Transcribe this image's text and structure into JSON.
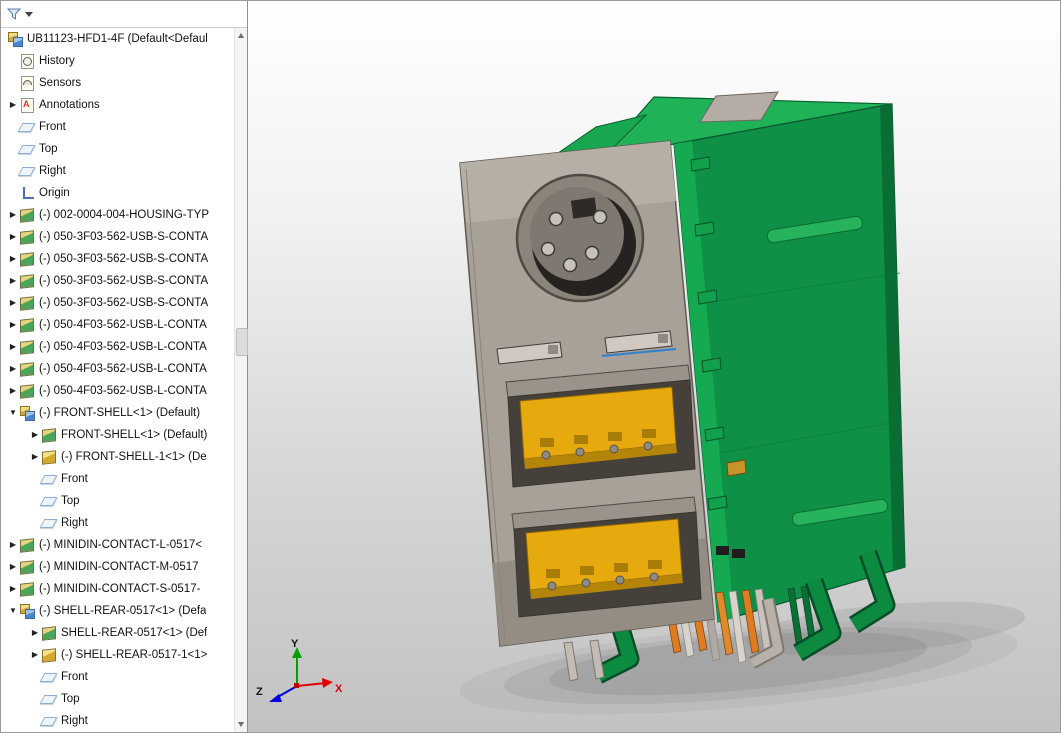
{
  "tree": {
    "root": {
      "label": "UB11123-HFD1-4F (Default<Defaul",
      "icon": "asm"
    },
    "items": [
      {
        "label": "History",
        "icon": "history",
        "arrow": "",
        "level": 1
      },
      {
        "label": "Sensors",
        "icon": "sensors",
        "arrow": "",
        "level": 1
      },
      {
        "label": "Annotations",
        "icon": "annotations",
        "arrow": "collapsed",
        "level": 1
      },
      {
        "label": "Front",
        "icon": "plane",
        "arrow": "",
        "level": 1
      },
      {
        "label": "Top",
        "icon": "plane",
        "arrow": "",
        "level": 1
      },
      {
        "label": "Right",
        "icon": "plane",
        "arrow": "",
        "level": 1
      },
      {
        "label": "Origin",
        "icon": "origin",
        "arrow": "",
        "level": 1
      },
      {
        "label": "(-) 002-0004-004-HOUSING-TYP",
        "icon": "part",
        "arrow": "collapsed",
        "level": 1
      },
      {
        "label": "(-) 050-3F03-562-USB-S-CONTA",
        "icon": "part",
        "arrow": "collapsed",
        "level": 1
      },
      {
        "label": "(-) 050-3F03-562-USB-S-CONTA",
        "icon": "part",
        "arrow": "collapsed",
        "level": 1
      },
      {
        "label": "(-) 050-3F03-562-USB-S-CONTA",
        "icon": "part",
        "arrow": "collapsed",
        "level": 1
      },
      {
        "label": "(-) 050-3F03-562-USB-S-CONTA",
        "icon": "part",
        "arrow": "collapsed",
        "level": 1
      },
      {
        "label": "(-) 050-4F03-562-USB-L-CONTA",
        "icon": "part",
        "arrow": "collapsed",
        "level": 1
      },
      {
        "label": "(-) 050-4F03-562-USB-L-CONTA",
        "icon": "part",
        "arrow": "collapsed",
        "level": 1
      },
      {
        "label": "(-) 050-4F03-562-USB-L-CONTA",
        "icon": "part",
        "arrow": "collapsed",
        "level": 1
      },
      {
        "label": "(-) 050-4F03-562-USB-L-CONTA",
        "icon": "part",
        "arrow": "collapsed",
        "level": 1
      },
      {
        "label": "(-) FRONT-SHELL<1> (Default)",
        "icon": "asm",
        "arrow": "expanded",
        "level": 1
      },
      {
        "label": "FRONT-SHELL<1> (Default)",
        "icon": "part",
        "arrow": "collapsed",
        "level": 2
      },
      {
        "label": "(-) FRONT-SHELL-1<1> (De",
        "icon": "asmy",
        "arrow": "collapsed",
        "level": 2
      },
      {
        "label": "Front",
        "icon": "plane",
        "arrow": "",
        "level": 2
      },
      {
        "label": "Top",
        "icon": "plane",
        "arrow": "",
        "level": 2
      },
      {
        "label": "Right",
        "icon": "plane",
        "arrow": "",
        "level": 2
      },
      {
        "label": "(-) MINIDIN-CONTACT-L-0517<",
        "icon": "part",
        "arrow": "collapsed",
        "level": 1
      },
      {
        "label": "(-) MINIDIN-CONTACT-M-0517",
        "icon": "part",
        "arrow": "collapsed",
        "level": 1
      },
      {
        "label": "(-) MINIDIN-CONTACT-S-0517-",
        "icon": "part",
        "arrow": "collapsed",
        "level": 1
      },
      {
        "label": "(-) SHELL-REAR-0517<1> (Defa",
        "icon": "asm",
        "arrow": "expanded",
        "level": 1
      },
      {
        "label": "SHELL-REAR-0517<1> (Def",
        "icon": "part",
        "arrow": "collapsed",
        "level": 2
      },
      {
        "label": "(-) SHELL-REAR-0517-1<1>",
        "icon": "asmy",
        "arrow": "collapsed",
        "level": 2
      },
      {
        "label": "Front",
        "icon": "plane",
        "arrow": "",
        "level": 2
      },
      {
        "label": "Top",
        "icon": "plane",
        "arrow": "",
        "level": 2
      },
      {
        "label": "Right",
        "icon": "plane",
        "arrow": "",
        "level": 2
      }
    ]
  },
  "viewport": {
    "triad": {
      "x": "X",
      "y": "Y",
      "z": "Z"
    },
    "colors": {
      "housing_green": "#0e9146",
      "housing_green_top": "#1fb257",
      "front_shell_gray": "#a7a198",
      "usb_tongue_gold": "#e6aa0e",
      "contact_orange": "#df7b20",
      "selection_highlight": "#2f80d0"
    }
  }
}
